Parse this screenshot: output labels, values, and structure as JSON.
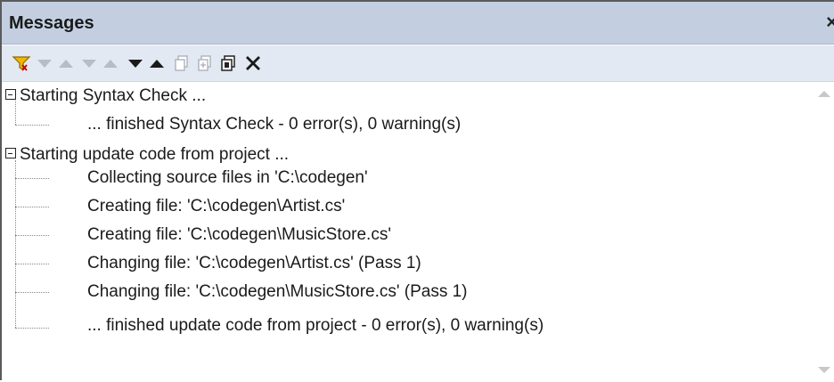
{
  "window": {
    "title": "Messages",
    "close_glyph": "×"
  },
  "toolbar": {
    "icons": [
      "filter-icon",
      "next-down-icon",
      "prev-up-icon",
      "next-warning-icon",
      "prev-warning-icon",
      "next-error-icon",
      "prev-error-icon",
      "copy-icon",
      "copy-all-icon",
      "copy-message-icon",
      "clear-icon"
    ]
  },
  "messages": [
    {
      "text": "Starting Syntax Check ...",
      "level": 0,
      "expanded": true
    },
    {
      "text": "... finished Syntax Check - 0 error(s), 0 warning(s)",
      "level": 1
    },
    {
      "text": "Starting update code from project ...",
      "level": 0,
      "expanded": true
    },
    {
      "text": "Collecting source files in 'C:\\codegen'",
      "level": 1
    },
    {
      "text": "Creating file: 'C:\\codegen\\Artist.cs'",
      "level": 1
    },
    {
      "text": "Creating file: 'C:\\codegen\\MusicStore.cs'",
      "level": 1
    },
    {
      "text": "Changing file: 'C:\\codegen\\Artist.cs' (Pass 1)",
      "level": 1
    },
    {
      "text": "Changing file: 'C:\\codegen\\MusicStore.cs' (Pass 1)",
      "level": 1
    },
    {
      "text": "... finished update code from project - 0 error(s), 0 warning(s)",
      "level": 1
    }
  ]
}
